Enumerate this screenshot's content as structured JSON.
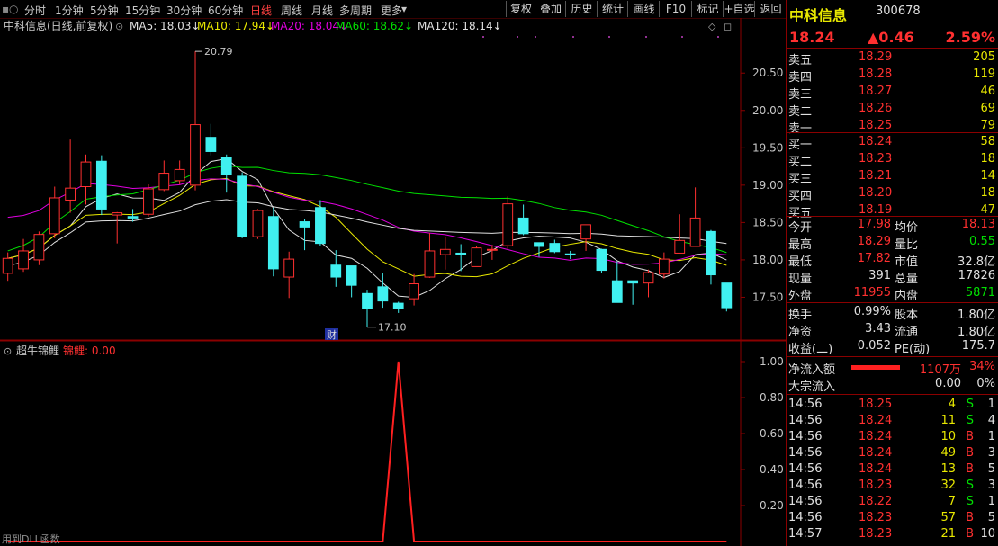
{
  "toolbar": {
    "periods": [
      "分时",
      "1分钟",
      "5分钟",
      "15分钟",
      "30分钟",
      "60分钟",
      "日线",
      "周线",
      "月线",
      "多周期",
      "更多"
    ],
    "active_period": "日线",
    "buttons": [
      "复权",
      "叠加",
      "历史",
      "统计",
      "画线",
      "F10",
      "标记",
      "+自选",
      "返回"
    ]
  },
  "main_chart": {
    "stock_label": "中科信息(日线,前复权)",
    "ma_labels": [
      {
        "text": "MA5: 18.03",
        "color": "#e0e0e0"
      },
      {
        "text": "MA10: 17.94",
        "color": "#e8e800"
      },
      {
        "text": "MA20: 18.04",
        "color": "#e000e0"
      },
      {
        "text": "MA60: 18.62",
        "color": "#00e000"
      },
      {
        "text": "MA120: 18.14",
        "color": "#e0e0e0"
      }
    ],
    "price_axis": [
      "20.50",
      "20.00",
      "19.50",
      "19.00",
      "18.50",
      "18.00",
      "17.50"
    ],
    "high_marker": "20.79",
    "low_marker": "17.10",
    "event_badge": "财",
    "colors": {
      "up": "#ff3030",
      "down": "#40f0f0",
      "ma5": "#e0e0e0",
      "ma10": "#e8e800",
      "ma20": "#e000e0",
      "ma60": "#00e000",
      "ma120": "#e0e0e0"
    }
  },
  "chart_data": {
    "type": "candlestick",
    "ylim": [
      17.0,
      20.9
    ],
    "candles": [
      [
        17.82,
        18.02,
        17.72,
        18.1
      ],
      [
        17.88,
        18.12,
        17.84,
        18.28
      ],
      [
        18.0,
        18.34,
        17.93,
        18.38
      ],
      [
        18.35,
        18.83,
        18.29,
        18.98
      ],
      [
        18.8,
        18.96,
        18.63,
        19.61
      ],
      [
        18.98,
        19.31,
        18.74,
        19.41
      ],
      [
        19.32,
        18.68,
        18.6,
        19.4
      ],
      [
        18.6,
        18.63,
        18.22,
        18.64
      ],
      [
        18.58,
        18.56,
        18.51,
        18.68
      ],
      [
        18.61,
        18.95,
        18.58,
        19.01
      ],
      [
        18.94,
        19.16,
        18.92,
        19.33
      ],
      [
        19.06,
        19.21,
        19.01,
        19.33
      ],
      [
        19.0,
        19.81,
        18.93,
        20.79
      ],
      [
        19.64,
        19.45,
        19.4,
        19.82
      ],
      [
        19.37,
        19.14,
        18.9,
        19.41
      ],
      [
        19.12,
        18.31,
        18.29,
        19.17
      ],
      [
        18.31,
        18.66,
        18.28,
        18.68
      ],
      [
        18.58,
        17.88,
        17.78,
        18.7
      ],
      [
        17.77,
        18.01,
        17.49,
        18.11
      ],
      [
        18.51,
        18.44,
        18.13,
        18.55
      ],
      [
        18.7,
        18.22,
        18.18,
        18.8
      ],
      [
        17.93,
        17.77,
        17.64,
        18.13
      ],
      [
        17.92,
        17.66,
        17.5,
        17.92
      ],
      [
        17.55,
        17.35,
        17.1,
        17.6
      ],
      [
        17.64,
        17.45,
        17.36,
        17.82
      ],
      [
        17.42,
        17.35,
        17.29,
        17.44
      ],
      [
        17.48,
        17.68,
        17.39,
        17.81
      ],
      [
        17.77,
        18.12,
        17.76,
        18.36
      ],
      [
        18.07,
        18.14,
        17.87,
        18.3
      ],
      [
        18.09,
        18.07,
        17.85,
        18.21
      ],
      [
        17.91,
        18.16,
        17.91,
        18.18
      ],
      [
        18.14,
        18.14,
        18.0,
        18.2
      ],
      [
        18.19,
        18.75,
        18.15,
        18.85
      ],
      [
        18.56,
        18.35,
        18.33,
        18.74
      ],
      [
        18.23,
        18.18,
        18.04,
        18.23
      ],
      [
        18.22,
        18.11,
        18.09,
        18.27
      ],
      [
        18.08,
        18.07,
        18.01,
        18.12
      ],
      [
        18.28,
        18.47,
        18.12,
        18.47
      ],
      [
        18.14,
        17.86,
        17.83,
        18.15
      ],
      [
        17.72,
        17.43,
        17.66,
        17.98
      ],
      [
        17.72,
        17.69,
        17.4,
        17.72
      ],
      [
        17.69,
        17.83,
        17.5,
        17.87
      ],
      [
        17.81,
        18.01,
        17.75,
        18.1
      ],
      [
        18.09,
        18.26,
        18.09,
        18.61
      ],
      [
        18.18,
        18.56,
        18.22,
        18.97
      ],
      [
        18.38,
        17.8,
        17.67,
        18.4
      ],
      [
        17.69,
        17.36,
        17.31,
        17.69
      ]
    ]
  },
  "indicator": {
    "name": "超牛锦鲤",
    "value_label": "锦鲤: 0.00",
    "axis": [
      "1.00",
      "0.80",
      "0.60",
      "0.40",
      "0.20"
    ],
    "spike_index": 25,
    "footer": "用到DLL函数"
  },
  "quote": {
    "name": "中科信息",
    "code": "300678",
    "price": "18.24",
    "change": "▲0.46",
    "pct": "2.59%",
    "asks": [
      {
        "label": "卖五",
        "price": "18.29",
        "vol": "205"
      },
      {
        "label": "卖四",
        "price": "18.28",
        "vol": "119"
      },
      {
        "label": "卖三",
        "price": "18.27",
        "vol": "46"
      },
      {
        "label": "卖二",
        "price": "18.26",
        "vol": "69"
      },
      {
        "label": "卖一",
        "price": "18.25",
        "vol": "79"
      }
    ],
    "bids": [
      {
        "label": "买一",
        "price": "18.24",
        "vol": "58"
      },
      {
        "label": "买二",
        "price": "18.23",
        "vol": "18"
      },
      {
        "label": "买三",
        "price": "18.21",
        "vol": "14"
      },
      {
        "label": "买四",
        "price": "18.20",
        "vol": "18"
      },
      {
        "label": "买五",
        "price": "18.19",
        "vol": "47"
      }
    ],
    "stats": [
      [
        {
          "l": "今开",
          "v": "17.98",
          "c": "red"
        },
        {
          "l": "均价",
          "v": "18.13",
          "c": "red"
        }
      ],
      [
        {
          "l": "最高",
          "v": "18.29",
          "c": "red"
        },
        {
          "l": "量比",
          "v": "0.55",
          "c": "green"
        }
      ],
      [
        {
          "l": "最低",
          "v": "17.82",
          "c": "red"
        },
        {
          "l": "市值",
          "v": "32.8亿",
          "c": "white"
        }
      ],
      [
        {
          "l": "现量",
          "v": "391",
          "c": "white"
        },
        {
          "l": "总量",
          "v": "17826",
          "c": "white"
        }
      ],
      [
        {
          "l": "外盘",
          "v": "11955",
          "c": "red"
        },
        {
          "l": "内盘",
          "v": "5871",
          "c": "green"
        }
      ]
    ],
    "stats2": [
      [
        {
          "l": "换手",
          "v": "0.99%"
        },
        {
          "l": "股本",
          "v": "1.80亿"
        }
      ],
      [
        {
          "l": "净资",
          "v": "3.43"
        },
        {
          "l": "流通",
          "v": "1.80亿"
        }
      ],
      [
        {
          "l": "收益(二)",
          "v": "0.052"
        },
        {
          "l": "PE(动)",
          "v": "175.7"
        }
      ]
    ],
    "netflow_label": "净流入额",
    "netflow_value": "1107万",
    "netflow_pct": "34%",
    "block_label": "大宗流入",
    "block_value": "0.00",
    "block_pct": "0%",
    "ticks": [
      {
        "t": "14:56",
        "p": "18.25",
        "v": "4",
        "s": "S",
        "n": "1"
      },
      {
        "t": "14:56",
        "p": "18.24",
        "v": "11",
        "s": "S",
        "n": "4"
      },
      {
        "t": "14:56",
        "p": "18.24",
        "v": "10",
        "s": "B",
        "n": "1"
      },
      {
        "t": "14:56",
        "p": "18.24",
        "v": "49",
        "s": "B",
        "n": "3"
      },
      {
        "t": "14:56",
        "p": "18.24",
        "v": "13",
        "s": "B",
        "n": "5"
      },
      {
        "t": "14:56",
        "p": "18.23",
        "v": "32",
        "s": "S",
        "n": "3"
      },
      {
        "t": "14:56",
        "p": "18.22",
        "v": "7",
        "s": "S",
        "n": "1"
      },
      {
        "t": "14:56",
        "p": "18.23",
        "v": "57",
        "s": "B",
        "n": "5"
      },
      {
        "t": "14:57",
        "p": "18.23",
        "v": "21",
        "s": "B",
        "n": "10"
      }
    ]
  }
}
